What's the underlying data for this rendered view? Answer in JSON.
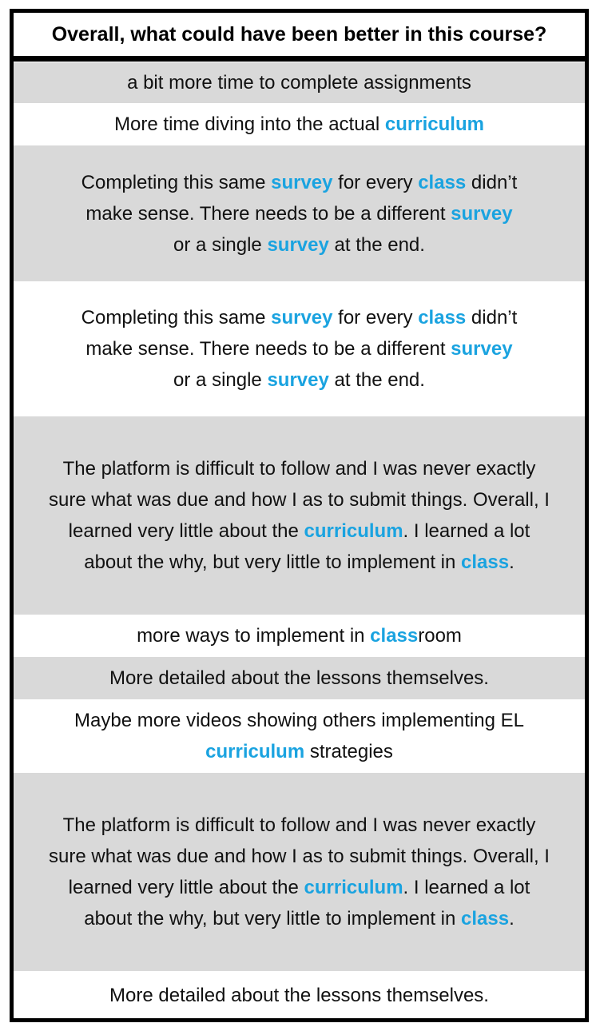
{
  "table": {
    "header": "Overall, what could have been better in this course?",
    "highlight_color": "#1aa3e0",
    "rows": [
      {
        "segments": [
          {
            "text": "a bit more time to complete assignments",
            "hl": false
          }
        ]
      },
      {
        "segments": [
          {
            "text": "More time diving into the actual ",
            "hl": false
          },
          {
            "text": "curriculum",
            "hl": true
          }
        ]
      },
      {
        "segments": [
          {
            "text": "Completing this same ",
            "hl": false
          },
          {
            "text": "survey",
            "hl": true
          },
          {
            "text": " for every ",
            "hl": false
          },
          {
            "text": "class",
            "hl": true
          },
          {
            "text": " didn’t make sense. There needs to be a different ",
            "hl": false
          },
          {
            "text": "survey",
            "hl": true
          },
          {
            "text": " or a single ",
            "hl": false
          },
          {
            "text": "survey",
            "hl": true
          },
          {
            "text": " at the end.",
            "hl": false
          }
        ]
      },
      {
        "segments": [
          {
            "text": "Completing this same ",
            "hl": false
          },
          {
            "text": "survey",
            "hl": true
          },
          {
            "text": " for every ",
            "hl": false
          },
          {
            "text": "class",
            "hl": true
          },
          {
            "text": " didn’t make sense. There needs to be a different ",
            "hl": false
          },
          {
            "text": "survey",
            "hl": true
          },
          {
            "text": " or a single ",
            "hl": false
          },
          {
            "text": "survey",
            "hl": true
          },
          {
            "text": " at the end.",
            "hl": false
          }
        ]
      },
      {
        "segments": [
          {
            "text": "The platform is difficult to follow and I was never exactly sure what was due and how I as to submit things. Overall, I learned very little about the ",
            "hl": false
          },
          {
            "text": "curriculum",
            "hl": true
          },
          {
            "text": ". I learned a lot about the why, but very little to implement in ",
            "hl": false
          },
          {
            "text": "class",
            "hl": true
          },
          {
            "text": ".",
            "hl": false
          }
        ]
      },
      {
        "segments": [
          {
            "text": "more ways to implement in ",
            "hl": false
          },
          {
            "text": "class",
            "hl": true
          },
          {
            "text": "room",
            "hl": false
          }
        ]
      },
      {
        "segments": [
          {
            "text": "More detailed about the lessons themselves.",
            "hl": false
          }
        ]
      },
      {
        "segments": [
          {
            "text": "Maybe more videos showing others implementing EL ",
            "hl": false
          },
          {
            "text": "curriculum",
            "hl": true
          },
          {
            "text": " strategies",
            "hl": false
          }
        ]
      },
      {
        "segments": [
          {
            "text": "The platform is difficult to follow and I was never exactly sure what was due and how I as to submit things. Overall, I learned very little about the ",
            "hl": false
          },
          {
            "text": "curriculum",
            "hl": true
          },
          {
            "text": ". I learned a lot about the why, but very little to implement in ",
            "hl": false
          },
          {
            "text": "class",
            "hl": true
          },
          {
            "text": ".",
            "hl": false
          }
        ]
      },
      {
        "segments": [
          {
            "text": "More detailed about the lessons themselves.",
            "hl": false
          }
        ]
      }
    ]
  }
}
